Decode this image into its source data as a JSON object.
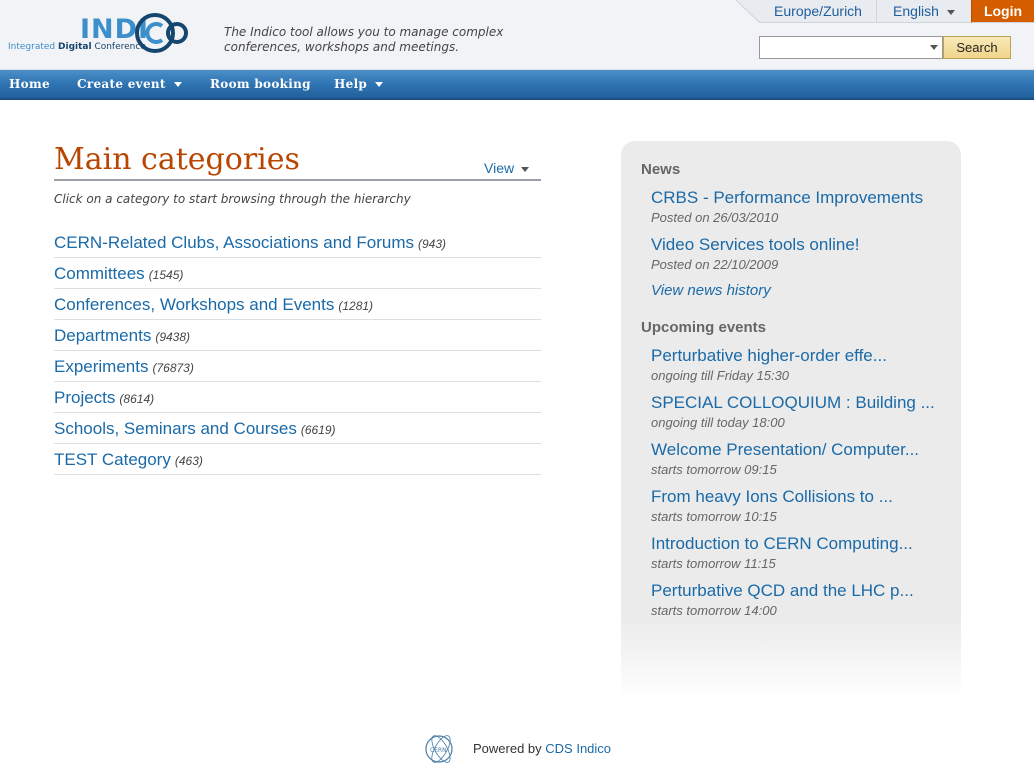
{
  "header": {
    "logo_main": "INDI",
    "logo_sub_light": "Integrated",
    "logo_sub_bold": "Digital",
    "logo_sub_end": "Conference",
    "tagline": "The Indico tool allows you to manage complex conferences, workshops and meetings.",
    "timezone": "Europe/Zurich",
    "language": "English",
    "login": "Login",
    "search": {
      "value": "",
      "placeholder": "",
      "button": "Search"
    }
  },
  "nav": {
    "items": [
      {
        "label": "Home",
        "dropdown": false
      },
      {
        "label": "Create event",
        "dropdown": true
      },
      {
        "label": "Room booking",
        "dropdown": false
      },
      {
        "label": "Help",
        "dropdown": true
      }
    ]
  },
  "main": {
    "title": "Main categories",
    "view_label": "View",
    "hint": "Click on a category to start browsing through the hierarchy",
    "categories": [
      {
        "name": "CERN-Related Clubs, Associations and Forums",
        "count": "(943)"
      },
      {
        "name": "Committees",
        "count": "(1545)"
      },
      {
        "name": "Conferences, Workshops and Events",
        "count": "(1281)"
      },
      {
        "name": "Departments",
        "count": "(9438)"
      },
      {
        "name": "Experiments",
        "count": "(76873)"
      },
      {
        "name": "Projects",
        "count": "(8614)"
      },
      {
        "name": "Schools, Seminars and Courses",
        "count": "(6619)"
      },
      {
        "name": "TEST Category",
        "count": "(463)"
      }
    ]
  },
  "sidebar": {
    "news_title": "News",
    "news": [
      {
        "title": "CRBS - Performance Improvements",
        "date": "Posted on 26/03/2010"
      },
      {
        "title": "Video Services tools online!",
        "date": "Posted on 22/10/2009"
      }
    ],
    "news_history": "View news history",
    "events_title": "Upcoming events",
    "events": [
      {
        "title": "Perturbative higher-order effe...",
        "when": "ongoing till Friday 15:30"
      },
      {
        "title": "SPECIAL COLLOQUIUM : Building ...",
        "when": "ongoing till today 18:00"
      },
      {
        "title": "Welcome Presentation/ Computer...",
        "when": "starts tomorrow 09:15"
      },
      {
        "title": "From heavy Ions Collisions to ...",
        "when": "starts tomorrow 10:15"
      },
      {
        "title": "Introduction to CERN Computing...",
        "when": "starts tomorrow 11:15"
      },
      {
        "title": "Perturbative QCD and the LHC p...",
        "when": "starts tomorrow 14:00"
      }
    ]
  },
  "footer": {
    "powered_by": "Powered by",
    "link": "CDS Indico",
    "icon": "cern-logo-icon"
  },
  "colors": {
    "brand_blue": "#3c8fca",
    "link_blue": "#1a6aa8",
    "title_orange": "#b84500",
    "login_orange": "#d45d00",
    "nav_blue": "#2f74b3"
  }
}
